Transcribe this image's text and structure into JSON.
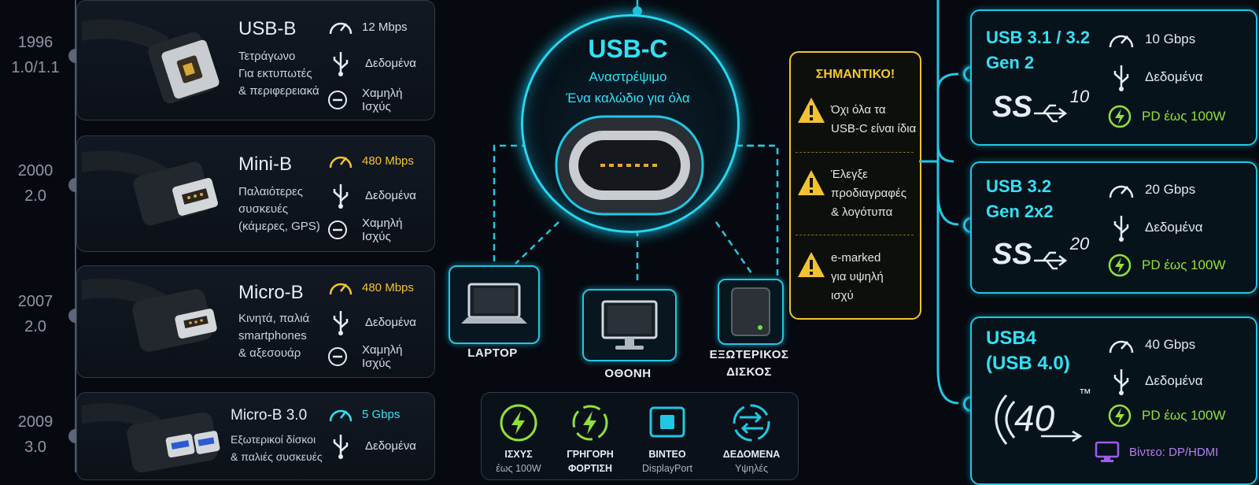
{
  "timeline": {
    "years": [
      {
        "year": "1996",
        "version": "1.0/1.1"
      },
      {
        "year": "2000",
        "version": "2.0"
      },
      {
        "year": "2007",
        "version": "2.0"
      },
      {
        "year": "2009",
        "version": "3.0"
      }
    ]
  },
  "connectors": [
    {
      "name": "USB-B",
      "desc": "Τετράγωνο\nΓια εκτυπωτές\n& περιφερειακά",
      "speed": "12 Mbps",
      "speed_color": "#e6edf3",
      "data": "Δεδομένα",
      "power": "Χαμηλή Ισχύς"
    },
    {
      "name": "Mini-B",
      "desc": "Παλαιότερες\nσυσκευές\n(κάμερες, GPS)",
      "speed": "480 Mbps",
      "speed_color": "#f2c230",
      "data": "Δεδομένα",
      "power": "Χαμηλή Ισχύς"
    },
    {
      "name": "Micro-B",
      "desc": "Κινητά, παλιά\nsmartphones\n& αξεσουάρ",
      "speed": "480 Mbps",
      "speed_color": "#f2c230",
      "data": "Δεδομένα",
      "power": "Χαμηλή Ισχύς"
    },
    {
      "name": "Micro-B 3.0",
      "desc": "Εξωτερικοί δίσκοι\n& παλιές συσκευές",
      "speed": "5 Gbps",
      "speed_color": "#34e0f5",
      "data": "Δεδομένα",
      "power": ""
    }
  ],
  "usbc": {
    "title": "USB-C",
    "line1": "Αναστρέψιμο",
    "line2": "Ένα καλώδιο για όλα"
  },
  "devices": [
    {
      "label": "LAPTOP",
      "icon": "laptop-icon"
    },
    {
      "label": "ΟΘΟΝΗ",
      "icon": "monitor-icon"
    },
    {
      "label": "ΕΞΩΤΕΡΙΚΟΣ\nΔΙΣΚΟΣ",
      "icon": "hard-drive-icon"
    }
  ],
  "features": [
    {
      "label": "ΙΣΧΥΣ",
      "sub": "έως 100W",
      "icon": "power-icon"
    },
    {
      "label": "ΓΡΗΓΟΡΗ",
      "sub": "ΦΟΡΤΙΣΗ",
      "icon": "fast-charge-icon"
    },
    {
      "label": "ΒΙΝΤΕΟ",
      "sub": "DisplayPort",
      "icon": "video-chip-icon"
    },
    {
      "label": "ΔΕΔΟΜΕΝΑ",
      "sub": "Υψηλές",
      "icon": "data-transfer-icon"
    }
  ],
  "warning": {
    "title": "ΣΗΜΑΝΤΙΚΟ!",
    "items": [
      "Όχι όλα τα\nUSB-C είναι ίδια",
      "Έλεγξε\nπροδιαγραφές\n& λογότυπα",
      "e-marked\nγια υψηλή\nισχύ"
    ]
  },
  "standards": [
    {
      "title": "USB 3.1 / 3.2\nGen 2",
      "logo_num": "10",
      "speed": "10 Gbps",
      "data": "Δεδομένα",
      "power": "PD έως 100W",
      "video": ""
    },
    {
      "title": "USB 3.2\nGen 2x2",
      "logo_num": "20",
      "speed": "20 Gbps",
      "data": "Δεδομένα",
      "power": "PD έως 100W",
      "video": ""
    },
    {
      "title": "USB4\n(USB 4.0)",
      "logo_num": "40",
      "logo_tm": "™",
      "speed": "40 Gbps",
      "data": "Δεδομένα",
      "power": "PD έως 100W",
      "video": "Βίντεο: DP/HDMI"
    }
  ],
  "colors": {
    "accent": "#22c7e3",
    "warning": "#f2c230",
    "power": "#8fe03a",
    "video": "#a05cf0"
  }
}
